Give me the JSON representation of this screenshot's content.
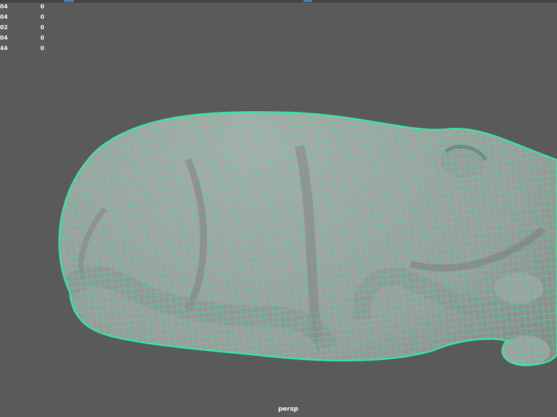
{
  "hud": {
    "rows": [
      {
        "label": "04",
        "value": "0"
      },
      {
        "label": "04",
        "value": "0"
      },
      {
        "label": "02",
        "value": "0"
      },
      {
        "label": "04",
        "value": "0"
      },
      {
        "label": "44",
        "value": "0"
      }
    ]
  },
  "viewport": {
    "camera_label": "persp",
    "background_color": "#5a5a5a",
    "mesh_fill_color": "#a3a3a3",
    "wireframe_color": "#2ff0a0",
    "object_icon": "frog-model-icon"
  }
}
